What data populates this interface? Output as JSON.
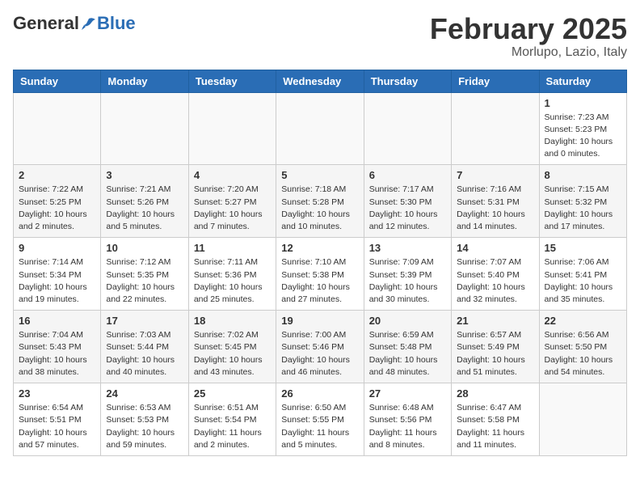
{
  "header": {
    "logo_general": "General",
    "logo_blue": "Blue",
    "month": "February 2025",
    "location": "Morlupo, Lazio, Italy"
  },
  "weekdays": [
    "Sunday",
    "Monday",
    "Tuesday",
    "Wednesday",
    "Thursday",
    "Friday",
    "Saturday"
  ],
  "weeks": [
    [
      {
        "day": "",
        "info": ""
      },
      {
        "day": "",
        "info": ""
      },
      {
        "day": "",
        "info": ""
      },
      {
        "day": "",
        "info": ""
      },
      {
        "day": "",
        "info": ""
      },
      {
        "day": "",
        "info": ""
      },
      {
        "day": "1",
        "info": "Sunrise: 7:23 AM\nSunset: 5:23 PM\nDaylight: 10 hours\nand 0 minutes."
      }
    ],
    [
      {
        "day": "2",
        "info": "Sunrise: 7:22 AM\nSunset: 5:25 PM\nDaylight: 10 hours\nand 2 minutes."
      },
      {
        "day": "3",
        "info": "Sunrise: 7:21 AM\nSunset: 5:26 PM\nDaylight: 10 hours\nand 5 minutes."
      },
      {
        "day": "4",
        "info": "Sunrise: 7:20 AM\nSunset: 5:27 PM\nDaylight: 10 hours\nand 7 minutes."
      },
      {
        "day": "5",
        "info": "Sunrise: 7:18 AM\nSunset: 5:28 PM\nDaylight: 10 hours\nand 10 minutes."
      },
      {
        "day": "6",
        "info": "Sunrise: 7:17 AM\nSunset: 5:30 PM\nDaylight: 10 hours\nand 12 minutes."
      },
      {
        "day": "7",
        "info": "Sunrise: 7:16 AM\nSunset: 5:31 PM\nDaylight: 10 hours\nand 14 minutes."
      },
      {
        "day": "8",
        "info": "Sunrise: 7:15 AM\nSunset: 5:32 PM\nDaylight: 10 hours\nand 17 minutes."
      }
    ],
    [
      {
        "day": "9",
        "info": "Sunrise: 7:14 AM\nSunset: 5:34 PM\nDaylight: 10 hours\nand 19 minutes."
      },
      {
        "day": "10",
        "info": "Sunrise: 7:12 AM\nSunset: 5:35 PM\nDaylight: 10 hours\nand 22 minutes."
      },
      {
        "day": "11",
        "info": "Sunrise: 7:11 AM\nSunset: 5:36 PM\nDaylight: 10 hours\nand 25 minutes."
      },
      {
        "day": "12",
        "info": "Sunrise: 7:10 AM\nSunset: 5:38 PM\nDaylight: 10 hours\nand 27 minutes."
      },
      {
        "day": "13",
        "info": "Sunrise: 7:09 AM\nSunset: 5:39 PM\nDaylight: 10 hours\nand 30 minutes."
      },
      {
        "day": "14",
        "info": "Sunrise: 7:07 AM\nSunset: 5:40 PM\nDaylight: 10 hours\nand 32 minutes."
      },
      {
        "day": "15",
        "info": "Sunrise: 7:06 AM\nSunset: 5:41 PM\nDaylight: 10 hours\nand 35 minutes."
      }
    ],
    [
      {
        "day": "16",
        "info": "Sunrise: 7:04 AM\nSunset: 5:43 PM\nDaylight: 10 hours\nand 38 minutes."
      },
      {
        "day": "17",
        "info": "Sunrise: 7:03 AM\nSunset: 5:44 PM\nDaylight: 10 hours\nand 40 minutes."
      },
      {
        "day": "18",
        "info": "Sunrise: 7:02 AM\nSunset: 5:45 PM\nDaylight: 10 hours\nand 43 minutes."
      },
      {
        "day": "19",
        "info": "Sunrise: 7:00 AM\nSunset: 5:46 PM\nDaylight: 10 hours\nand 46 minutes."
      },
      {
        "day": "20",
        "info": "Sunrise: 6:59 AM\nSunset: 5:48 PM\nDaylight: 10 hours\nand 48 minutes."
      },
      {
        "day": "21",
        "info": "Sunrise: 6:57 AM\nSunset: 5:49 PM\nDaylight: 10 hours\nand 51 minutes."
      },
      {
        "day": "22",
        "info": "Sunrise: 6:56 AM\nSunset: 5:50 PM\nDaylight: 10 hours\nand 54 minutes."
      }
    ],
    [
      {
        "day": "23",
        "info": "Sunrise: 6:54 AM\nSunset: 5:51 PM\nDaylight: 10 hours\nand 57 minutes."
      },
      {
        "day": "24",
        "info": "Sunrise: 6:53 AM\nSunset: 5:53 PM\nDaylight: 10 hours\nand 59 minutes."
      },
      {
        "day": "25",
        "info": "Sunrise: 6:51 AM\nSunset: 5:54 PM\nDaylight: 11 hours\nand 2 minutes."
      },
      {
        "day": "26",
        "info": "Sunrise: 6:50 AM\nSunset: 5:55 PM\nDaylight: 11 hours\nand 5 minutes."
      },
      {
        "day": "27",
        "info": "Sunrise: 6:48 AM\nSunset: 5:56 PM\nDaylight: 11 hours\nand 8 minutes."
      },
      {
        "day": "28",
        "info": "Sunrise: 6:47 AM\nSunset: 5:58 PM\nDaylight: 11 hours\nand 11 minutes."
      },
      {
        "day": "",
        "info": ""
      }
    ]
  ]
}
